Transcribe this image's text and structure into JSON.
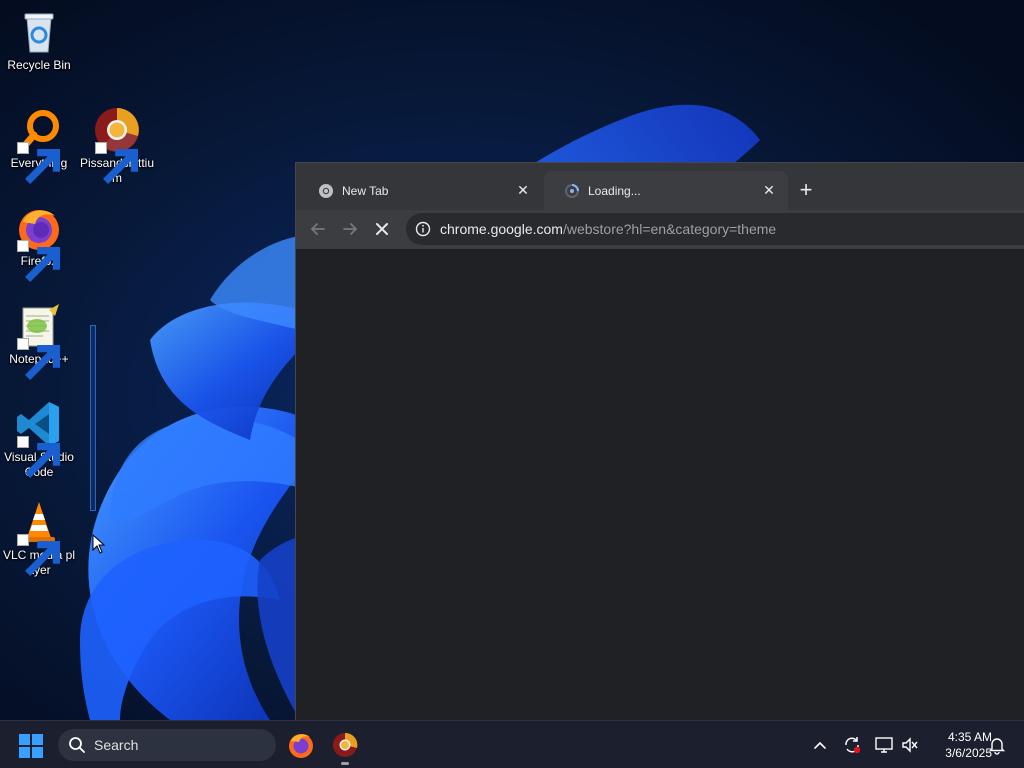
{
  "desktop": {
    "icons": [
      {
        "label": "Recycle Bin",
        "icon": "recycle-bin-icon",
        "shortcut": false
      },
      {
        "label": "Everything",
        "icon": "everything-search-icon",
        "shortcut": true
      },
      {
        "label": "Pissandshittium",
        "icon": "chromium-icon",
        "shortcut": true
      },
      {
        "label": "Firefox",
        "icon": "firefox-icon",
        "shortcut": true
      },
      {
        "label": "Notepad++",
        "icon": "notepad-plus-plus-icon",
        "shortcut": true
      },
      {
        "label": "Visual Studio Code",
        "icon": "vscode-icon",
        "shortcut": true
      },
      {
        "label": "VLC media player",
        "icon": "vlc-icon",
        "shortcut": true
      }
    ]
  },
  "browser": {
    "tabs": [
      {
        "title": "New Tab",
        "favicon": "chrome-icon",
        "active": false,
        "close": "✕"
      },
      {
        "title": "Loading...",
        "favicon": "loading-spinner-icon",
        "active": true,
        "close": "✕"
      }
    ],
    "new_tab_label": "+",
    "toolbar": {
      "back": "back-arrow-icon",
      "forward": "forward-arrow-icon",
      "stop": "stop-loading-icon"
    },
    "address": {
      "domain": "chrome.google.com",
      "path": "/webstore?hl=en&category=theme",
      "site_info_icon": "info-icon"
    }
  },
  "taskbar": {
    "start_icon": "windows-start-icon",
    "search_placeholder": "Search",
    "pinned": [
      {
        "app": "Firefox",
        "icon": "firefox-icon",
        "running": false
      },
      {
        "app": "Pissandshittium",
        "icon": "chromium-icon",
        "running": true
      }
    ],
    "tray": [
      "show-hidden-icons-chevron",
      "update-sync-icon",
      "network-display-icon",
      "volume-muted-icon"
    ],
    "time": "4:35 AM",
    "date": "3/6/2025",
    "notifications_icon": "notification-bell-icon"
  },
  "colors": {
    "browser_bg": "#202124",
    "tabstrip": "#35363a",
    "toolbar": "#3c3d41",
    "taskbar": "#1b1f2e",
    "wallpaper_accent": "#1f5fff"
  }
}
